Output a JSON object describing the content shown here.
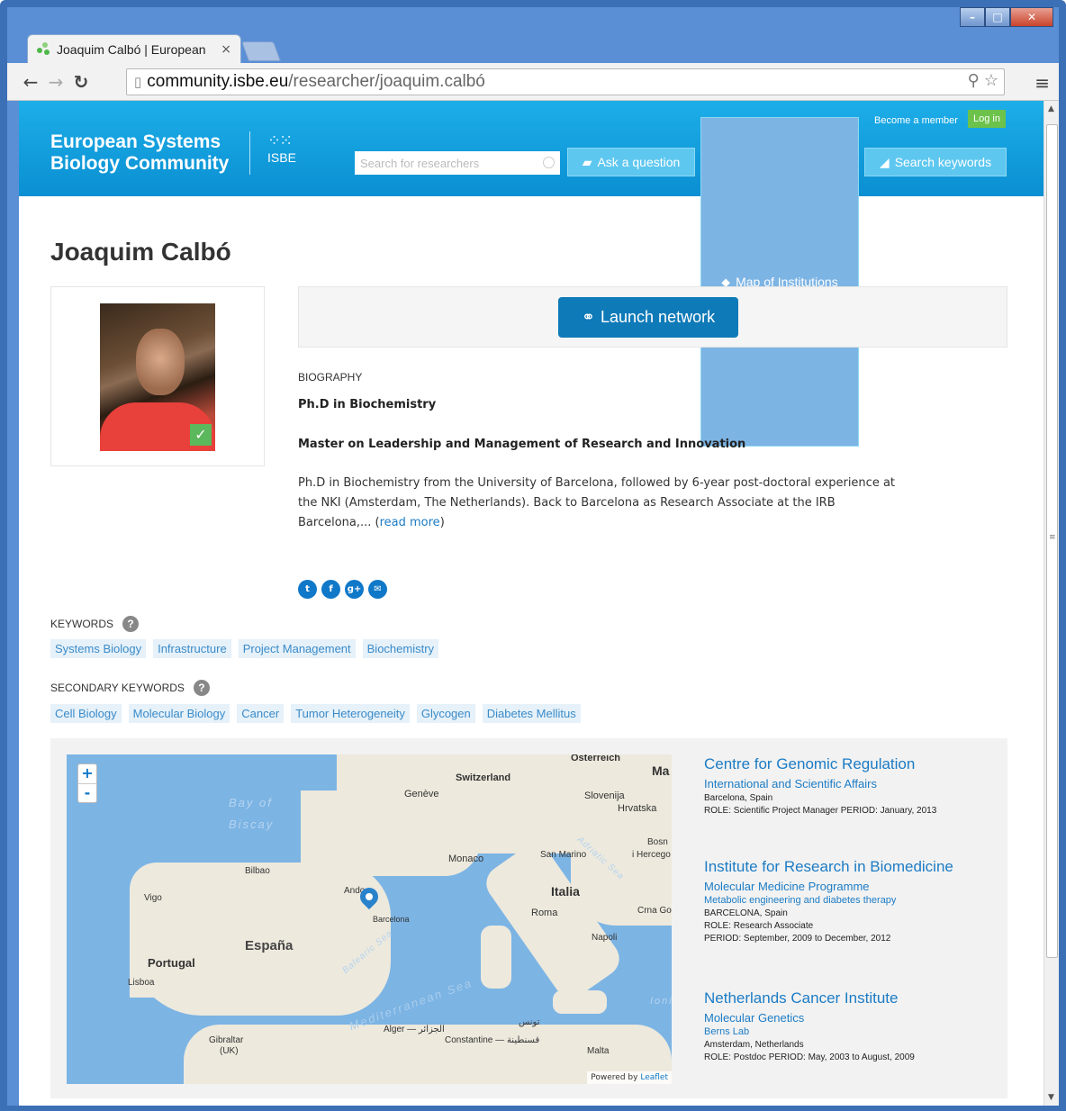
{
  "browser": {
    "tab_title": "Joaquim Calbó | European",
    "tab_close": "×",
    "url_host": "community.isbe.eu",
    "url_path": "/researcher/joaquim.calbó",
    "icons": [
      "back-icon",
      "forward-icon",
      "reload-icon",
      "page-icon",
      "search-icon",
      "star-icon",
      "menu-icon"
    ]
  },
  "header": {
    "brand_line1": "European Systems",
    "brand_line2": "Biology Community",
    "logo_text": "ISBE",
    "become_member": "Become a member",
    "login": "Log in",
    "search_placeholder": "Search for researchers",
    "ask": "Ask a question",
    "map": "Map of Institutions",
    "keywords": "Search keywords",
    "accent": "#0f9ad9"
  },
  "profile": {
    "name": "Joaquim Calbó",
    "launch_network": "Launch network",
    "biography_heading": "BIOGRAPHY",
    "degree1": "Ph.D in Biochemistry",
    "degree2": "Master on Leadership and Management of Research and Innovation",
    "bio_text": "Ph.D in Biochemistry from the University of Barcelona, followed by 6-year post-doctoral experience at the NKI (Amsterdam, The Netherlands). Back to Barcelona as Research Associate at the IRB Barcelona,... (",
    "read_more": "read more",
    "bio_close": ")"
  },
  "keywords": {
    "heading": "KEYWORDS",
    "items": [
      "Systems Biology",
      "Infrastructure",
      "Project Management",
      "Biochemistry"
    ]
  },
  "secondary_keywords": {
    "heading": "SECONDARY KEYWORDS",
    "items": [
      "Cell Biology",
      "Molecular Biology",
      "Cancer",
      "Tumor Heterogeneity",
      "Glycogen",
      "Diabetes Mellitus"
    ]
  },
  "map": {
    "labels": {
      "osterreich": "Österreich",
      "switzerland": "Switzerland",
      "geneve": "Genève",
      "slovenija": "Slovenija",
      "hrvatska": "Hrvatska",
      "bay1": "Bay of",
      "bay2": "Biscay",
      "bosna": "Bosn",
      "hercego": "i Hercego",
      "monaco": "Monaco",
      "sanmarino": "San Marino",
      "bilbao": "Bilbao",
      "andorra": "Ando",
      "italia": "Italia",
      "vigo": "Vigo",
      "roma": "Roma",
      "crnago": "Crna Go",
      "barcelona": "Barcelona",
      "napoli": "Napoli",
      "espana": "España",
      "portugal": "Portugal",
      "lisboa": "Lisboa",
      "mediterranean": "Mediterranean Sea",
      "balearic": "Balearic Sea",
      "adriatic": "Adriatic Sea",
      "ionian": "Ioni",
      "alger": "Alger — الجزائر",
      "constantine": "Constantine — قسنطينة",
      "tunis": "تونس",
      "gibraltar": "Gibraltar",
      "uk": "(UK)",
      "malta": "Malta",
      "ma": "Ma"
    },
    "zoom_in": "+",
    "zoom_out": "-",
    "powered_by": "Powered by",
    "leaflet": "Leaflet"
  },
  "institutions": [
    {
      "name": "Centre for Genomic Regulation",
      "dept": "International and Scientific Affairs",
      "sub": "",
      "location": "Barcelona, Spain",
      "meta": "ROLE:  Scientific Project Manager    PERIOD:  January, 2013"
    },
    {
      "name": "Institute for Research in Biomedicine",
      "dept": "Molecular Medicine Programme",
      "sub": "Metabolic engineering and diabetes therapy",
      "location": "BARCELONA, Spain",
      "meta": "ROLE:  Research Associate",
      "meta2": "PERIOD:  September, 2009 to December, 2012"
    },
    {
      "name": "Netherlands Cancer Institute",
      "dept": "Molecular Genetics",
      "sub": "Berns Lab",
      "location": "Amsterdam, Netherlands",
      "meta": "ROLE:  Postdoc    PERIOD:  May, 2003 to August, 2009"
    }
  ]
}
